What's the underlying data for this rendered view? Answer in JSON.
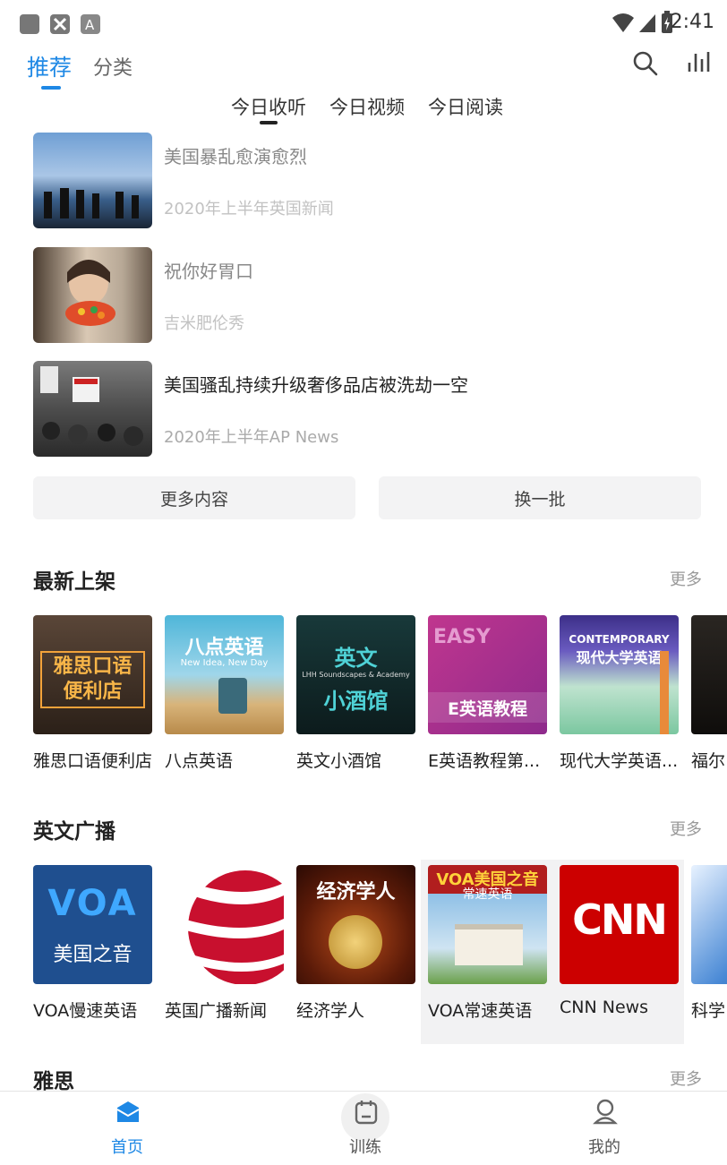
{
  "status": {
    "time": "2:41"
  },
  "header": {
    "tabs": [
      {
        "label": "推荐"
      },
      {
        "label": "分类"
      }
    ],
    "sub_tabs": [
      {
        "label": "今日收听"
      },
      {
        "label": "今日视频"
      },
      {
        "label": "今日阅读"
      }
    ]
  },
  "feed": [
    {
      "title": "美国暴乱愈演愈烈",
      "subtitle": "2020年上半年英国新闻"
    },
    {
      "title": "祝你好胃口",
      "subtitle": "吉米肥伦秀"
    },
    {
      "title": "美国骚乱持续升级奢侈品店被洗劫一空",
      "subtitle": "2020年上半年AP News"
    }
  ],
  "buttons": {
    "more_content": "更多内容",
    "refresh": "换一批"
  },
  "sections": [
    {
      "title": "最新上架",
      "more": "更多",
      "items": [
        {
          "label": "雅思口语便利店",
          "cover_text": "雅思口语\n便利店"
        },
        {
          "label": "八点英语",
          "cover_text": "八点英语",
          "cover_sub": "New Idea, New Day"
        },
        {
          "label": "英文小酒馆",
          "cover_text": "英文",
          "cover_text2": "小酒馆",
          "cover_sub": "LHH Soundscapes & Academy"
        },
        {
          "label": "E英语教程第...",
          "cover_text": "EASY",
          "cover_text2": "E英语教程"
        },
        {
          "label": "现代大学英语...",
          "cover_text": "CONTEMPORARY",
          "cover_text2": "现代大学英语"
        },
        {
          "label": "福尔"
        }
      ]
    },
    {
      "title": "英文广播",
      "more": "更多",
      "items": [
        {
          "label": "VOA慢速英语",
          "cover_text": "VOA",
          "cover_text2": "美国之音"
        },
        {
          "label": "英国广播新闻"
        },
        {
          "label": "经济学人",
          "cover_text": "经济学人"
        },
        {
          "label": "VOA常速英语",
          "cover_text": "VOA美国之音",
          "cover_text2": "常速英语"
        },
        {
          "label": "CNN News",
          "cover_text": "CNN"
        },
        {
          "label": "科学"
        }
      ]
    },
    {
      "title": "雅思",
      "more": "更多"
    }
  ],
  "bottom_nav": [
    {
      "label": "首页",
      "icon": "home-icon"
    },
    {
      "label": "训练",
      "icon": "calendar-icon"
    },
    {
      "label": "我的",
      "icon": "user-icon"
    }
  ],
  "colors": {
    "accent": "#1e88e5"
  }
}
